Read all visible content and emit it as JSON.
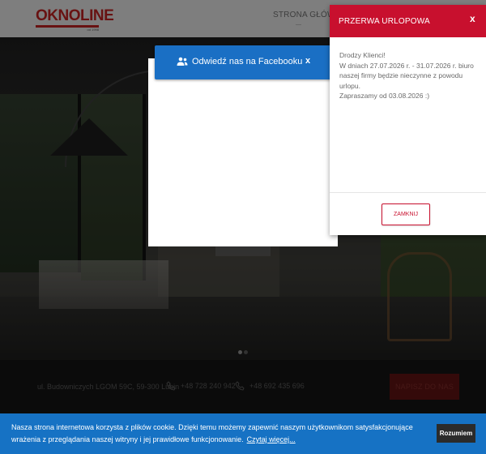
{
  "header": {
    "logo_text": "OKNOLINE",
    "logo_subtext": "od 1998",
    "nav": {
      "home_label": "STRONA GŁÓWNA"
    }
  },
  "hero": {
    "slide_indicators": {
      "count": 2,
      "active_index": 0
    },
    "colors": {
      "dot_active": "#8a8a8a",
      "dot_inactive": "#555555"
    }
  },
  "contact_bar": {
    "address": "ul. Budowniczych LGOM 59C, 59-300 Lubin",
    "phone_1": "+48 728 240 942",
    "phone_2": "+48 692 435 696",
    "write_button_label": "NAPISZ DO NAS"
  },
  "facebook_widget": {
    "title": "Odwiedź nas na Facebooku",
    "close_label": "x",
    "icon": "users-icon",
    "color": "#1a6fc4"
  },
  "vacation_modal": {
    "title": "PRZERWA URLOPOWA",
    "close_label": "x",
    "greeting": "Drodzy Klienci!",
    "message": "W dniach 27.07.2026 r. - 31.07.2026 r. biuro naszej firmy będzie nieczynne z powodu urlopu.",
    "return_note": "Zapraszamy od 03.08.2026 :)",
    "dismiss_label": "ZAMKNIJ",
    "color": "#c8102e"
  },
  "cookie_bar": {
    "text": "Nasza strona internetowa korzysta z plików cookie. Dzięki temu możemy zapewnić naszym użytkownikom satysfakcjonujące wrażenia z przeglądania naszej witryny i jej prawidłowe funkcjonowanie.",
    "link_label": "Czytaj więcej...",
    "accept_label": "Rozumiem",
    "color": "#1672c4"
  }
}
